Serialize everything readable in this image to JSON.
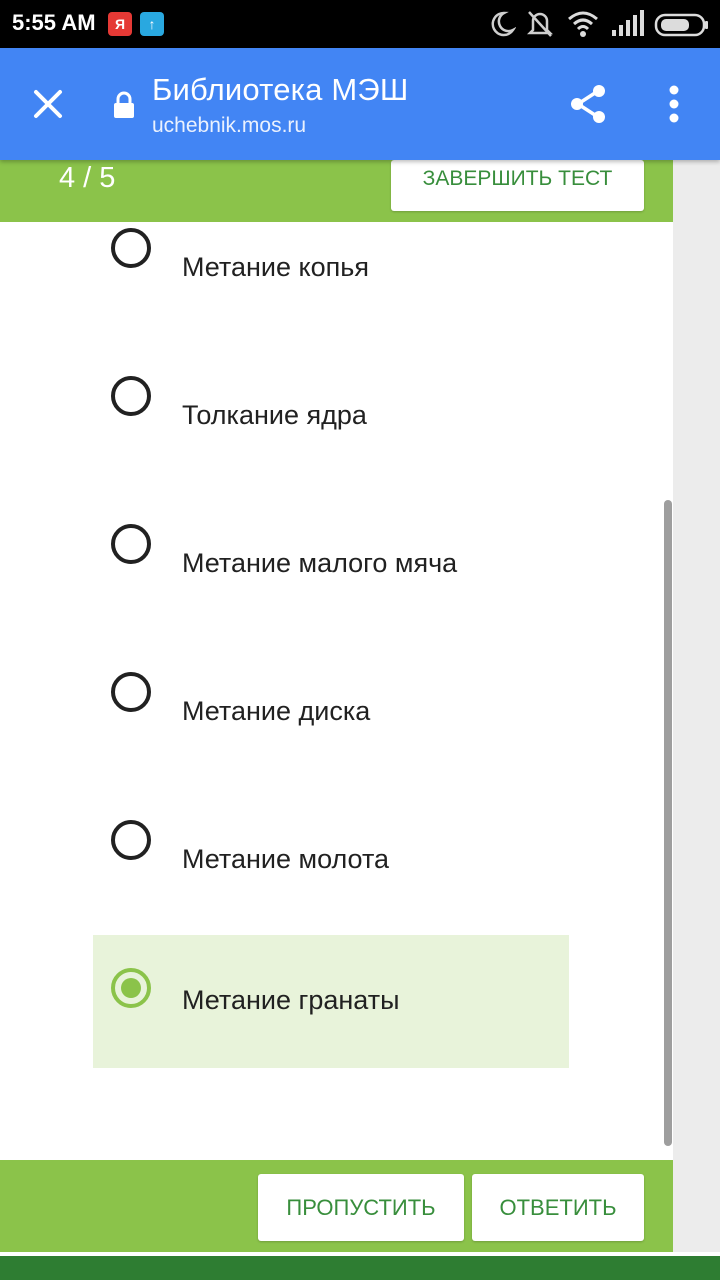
{
  "status_bar": {
    "time": "5:55 AM",
    "left_icons": [
      "yandex-icon",
      "upload-icon"
    ],
    "right_icons": [
      "moon-icon",
      "mute-icon",
      "wifi-icon",
      "signal-icon",
      "battery-icon"
    ]
  },
  "app_bar": {
    "title": "Библиотека МЭШ",
    "url": "uchebnik.mos.ru",
    "color": "#4285f4"
  },
  "test_header": {
    "progress": "4 / 5",
    "finish_label": "ЗАВЕРШИТЬ ТЕСТ",
    "color": "#8bc34a"
  },
  "options": [
    {
      "label": "Метание копья",
      "selected": false
    },
    {
      "label": "Толкание ядра",
      "selected": false
    },
    {
      "label": "Метание малого мяча",
      "selected": false
    },
    {
      "label": "Метание диска",
      "selected": false
    },
    {
      "label": "Метание молота",
      "selected": false
    },
    {
      "label": "Метание гранаты",
      "selected": true
    }
  ],
  "footer": {
    "skip_label": "ПРОПУСТИТЬ",
    "answer_label": "ОТВЕТИТЬ"
  },
  "colors": {
    "accent_green": "#8bc34a",
    "button_text_green": "#388e3c",
    "selected_bg": "#e8f3da",
    "bottom_strip": "#2e7d32"
  }
}
